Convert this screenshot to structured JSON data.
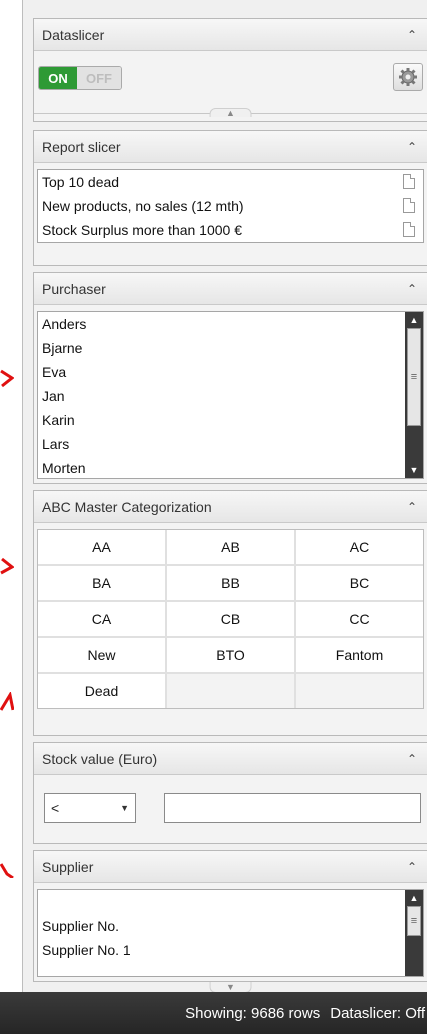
{
  "dataslicer": {
    "title": "Dataslicer",
    "toggle_on": "ON",
    "toggle_off": "OFF",
    "collapse_icon": "double-chevron-up"
  },
  "report_slicer": {
    "title": "Report slicer",
    "items": [
      {
        "label": "Top 10 dead"
      },
      {
        "label": "New products, no sales (12 mth)"
      },
      {
        "label": "Stock Surplus more than 1000 €"
      }
    ]
  },
  "purchaser": {
    "title": "Purchaser",
    "items": [
      {
        "label": "Anders"
      },
      {
        "label": "Bjarne"
      },
      {
        "label": "Eva"
      },
      {
        "label": "Jan"
      },
      {
        "label": "Karin"
      },
      {
        "label": "Lars"
      },
      {
        "label": "Morten"
      }
    ]
  },
  "abc": {
    "title": "ABC Master Categorization",
    "cells": [
      "AA",
      "AB",
      "AC",
      "BA",
      "BB",
      "BC",
      "CA",
      "CB",
      "CC",
      "New",
      "BTO",
      "Fantom",
      "Dead"
    ]
  },
  "stock_value": {
    "title": "Stock value (Euro)",
    "operator": "<",
    "value": ""
  },
  "supplier": {
    "title": "Supplier",
    "items": [
      {
        "label": ""
      },
      {
        "label": "Supplier No."
      },
      {
        "label": "Supplier No. 1"
      }
    ]
  },
  "status": {
    "rows": "Showing: 9686 rows",
    "dataslicer": "Dataslicer: Off"
  },
  "colors": {
    "toggle_on": "#2e9a35",
    "statusbar": "#2e2e2e",
    "annotation": "#e01010"
  }
}
